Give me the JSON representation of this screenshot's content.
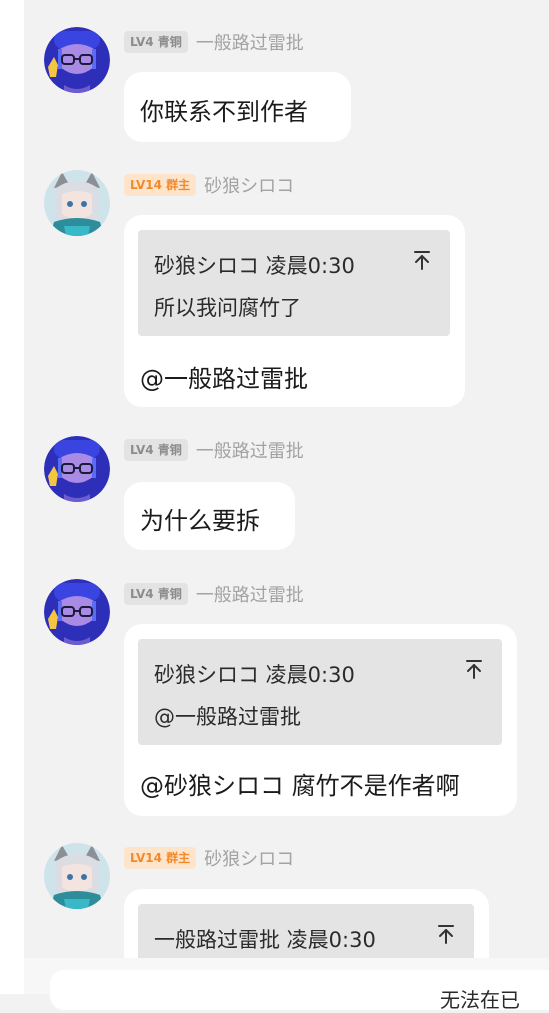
{
  "messages": [
    {
      "badge": "LV4 青铜",
      "badge_color": "#8c8c8c",
      "nickname": "一般路过雷批",
      "avatar_icon": "blue-hair-glasses-avatar",
      "text": "你联系不到作者"
    },
    {
      "badge": "LV14 群主",
      "badge_color": "#f08a2c",
      "nickname": "砂狼シロコ",
      "avatar_icon": "white-hair-wolf-ears-avatar",
      "quote": {
        "author_time": "砂狼シロコ 凌晨0:30",
        "text": "所以我问腐竹了"
      },
      "text": "@一般路过雷批"
    },
    {
      "badge": "LV4 青铜",
      "badge_color": "#8c8c8c",
      "nickname": "一般路过雷批",
      "avatar_icon": "blue-hair-glasses-avatar",
      "text": "为什么要拆"
    },
    {
      "badge": "LV4 青铜",
      "badge_color": "#8c8c8c",
      "nickname": "一般路过雷批",
      "avatar_icon": "blue-hair-glasses-avatar",
      "quote": {
        "author_time": "砂狼シロコ 凌晨0:30",
        "text": "@一般路过雷批"
      },
      "text": "@砂狼シロコ 腐竹不是作者啊"
    },
    {
      "badge": "LV14 群主",
      "badge_color": "#f08a2c",
      "nickname": "砂狼シロコ",
      "avatar_icon": "white-hair-wolf-ears-avatar",
      "quote": {
        "author_time": "一般路过雷批 凌晨0:30"
      }
    }
  ],
  "input_bar": {
    "partial_text": "无法在已"
  }
}
